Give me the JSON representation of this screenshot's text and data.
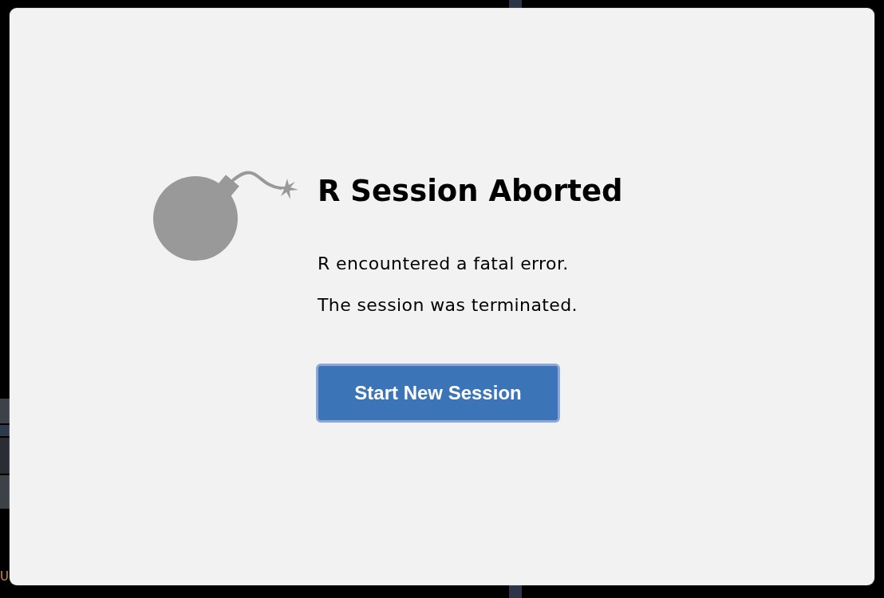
{
  "backdrop": {
    "text_fragment": "U"
  },
  "dialog": {
    "title": "R Session Aborted",
    "messages": [
      "R encountered a fatal error.",
      "The session was terminated."
    ],
    "button": {
      "label": "Start New Session",
      "focused": true
    }
  }
}
